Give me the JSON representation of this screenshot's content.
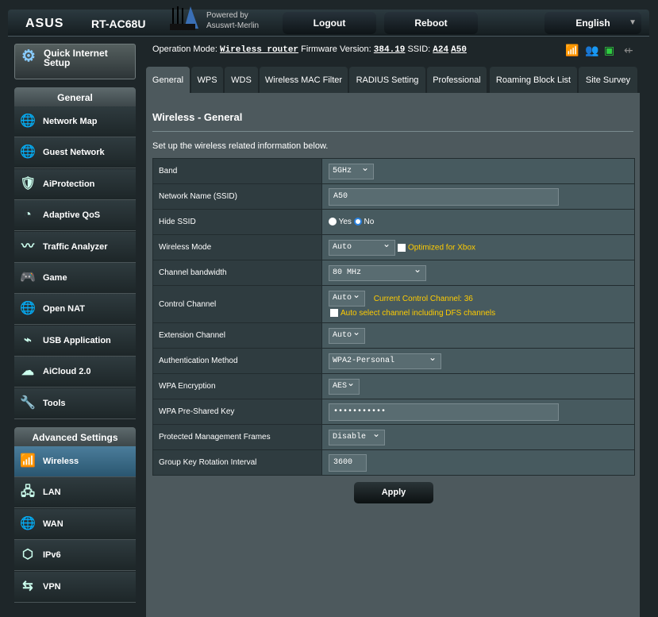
{
  "header": {
    "logo": "ASUS",
    "model": "RT-AC68U",
    "powered_by": "Powered by",
    "firmware_brand": "Asuswrt-Merlin",
    "logout": "Logout",
    "reboot": "Reboot",
    "language": "English"
  },
  "status": {
    "op_mode_label": "Operation Mode:",
    "op_mode": "Wireless router",
    "fw_label": "Firmware Version:",
    "fw": "384.19",
    "ssid_label": "SSID:",
    "ssid1": "A24",
    "ssid2": "A50"
  },
  "sidebar": {
    "quick_setup": "Quick Internet Setup",
    "general_head": "General",
    "general": [
      {
        "label": "Network Map",
        "icon": "globe"
      },
      {
        "label": "Guest Network",
        "icon": "globe-users"
      },
      {
        "label": "AiProtection",
        "icon": "lock-shield"
      },
      {
        "label": "Adaptive QoS",
        "icon": "gauge"
      },
      {
        "label": "Traffic Analyzer",
        "icon": "pulse"
      },
      {
        "label": "Game",
        "icon": "gamepad"
      },
      {
        "label": "Open NAT",
        "icon": "globe-gamepad"
      },
      {
        "label": "USB Application",
        "icon": "usb"
      },
      {
        "label": "AiCloud 2.0",
        "icon": "cloud"
      },
      {
        "label": "Tools",
        "icon": "wrench"
      }
    ],
    "advanced_head": "Advanced Settings",
    "advanced": [
      {
        "label": "Wireless",
        "icon": "wifi",
        "selected": true
      },
      {
        "label": "LAN",
        "icon": "lan"
      },
      {
        "label": "WAN",
        "icon": "globe"
      },
      {
        "label": "IPv6",
        "icon": "ipv6"
      },
      {
        "label": "VPN",
        "icon": "vpn"
      }
    ]
  },
  "tabs": [
    "General",
    "WPS",
    "WDS",
    "Wireless MAC Filter",
    "RADIUS Setting",
    "Professional",
    "Roaming Block List",
    "Site Survey"
  ],
  "main": {
    "title": "Wireless - General",
    "desc": "Set up the wireless related information below.",
    "band_label": "Band",
    "band": "5GHz",
    "ssid_label": "Network Name (SSID)",
    "ssid": "A50",
    "hide_label": "Hide SSID",
    "yes": "Yes",
    "no": "No",
    "mode_label": "Wireless Mode",
    "mode": "Auto",
    "xbox": "Optimized for Xbox",
    "bw_label": "Channel bandwidth",
    "bw": "80 MHz",
    "cc_label": "Control Channel",
    "cc": "Auto",
    "cc_current": "Current Control Channel: 36",
    "dfs": "Auto select channel including DFS channels",
    "ext_label": "Extension Channel",
    "ext": "Auto",
    "auth_label": "Authentication Method",
    "auth": "WPA2-Personal",
    "enc_label": "WPA Encryption",
    "enc": "AES",
    "psk_label": "WPA Pre-Shared Key",
    "psk": "•••••••••••",
    "pmf_label": "Protected Management Frames",
    "pmf": "Disable",
    "gkr_label": "Group Key Rotation Interval",
    "gkr": "3600",
    "apply": "Apply"
  },
  "colors": {
    "accent": "#ffcc00",
    "selected": "#3b6e8f",
    "wifi_status": "#2ecc40"
  }
}
